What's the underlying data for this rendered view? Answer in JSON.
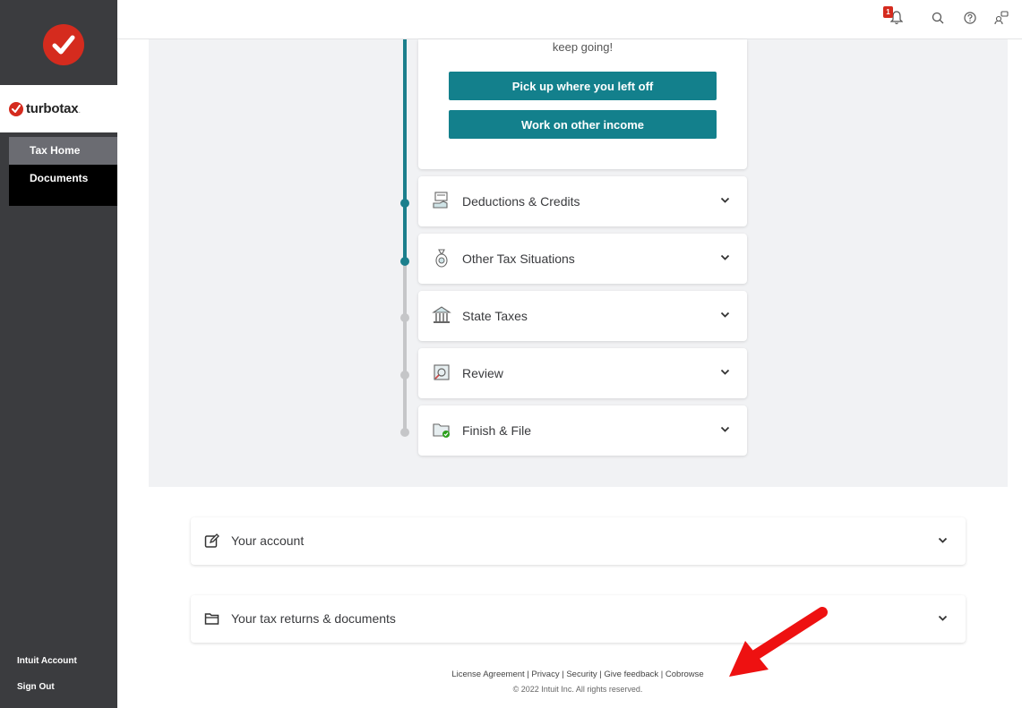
{
  "brand": {
    "name": "turbotax",
    "suffix": "."
  },
  "sidebar": {
    "items": [
      {
        "label": "Tax Home",
        "active": true
      },
      {
        "label": "Documents",
        "active": false
      }
    ],
    "bottom": {
      "account_label": "Intuit Account",
      "signout_label": "Sign Out"
    }
  },
  "topbar": {
    "notification_count": "1",
    "icons": [
      "bell-icon",
      "search-icon",
      "help-icon",
      "connect-icon"
    ]
  },
  "main": {
    "top_card": {
      "message": "keep going!",
      "primary_button": "Pick up where you left off",
      "secondary_button": "Work on other income"
    },
    "sections": [
      {
        "label": "Deductions & Credits",
        "icon": "receipt-hand-icon",
        "status": "active"
      },
      {
        "label": "Other Tax Situations",
        "icon": "money-bag-icon",
        "status": "active"
      },
      {
        "label": "State Taxes",
        "icon": "state-building-icon",
        "status": "pending"
      },
      {
        "label": "Review",
        "icon": "magnifier-document-icon",
        "status": "pending"
      },
      {
        "label": "Finish & File",
        "icon": "folder-check-icon",
        "status": "pending"
      }
    ]
  },
  "panels": {
    "account": {
      "label": "Your account",
      "icon": "edit-icon"
    },
    "returns": {
      "label": "Your tax returns & documents",
      "icon": "folder-icon"
    }
  },
  "footer": {
    "links": [
      "License Agreement",
      "Privacy",
      "Security",
      "Give feedback",
      "Cobrowse"
    ],
    "copyright": "© 2022 Intuit Inc. All rights reserved."
  },
  "colors": {
    "teal": "#13808c",
    "brand_red": "#d52b1e",
    "sidebar": "#3b3c3f",
    "annotation_red": "#ee1111"
  }
}
